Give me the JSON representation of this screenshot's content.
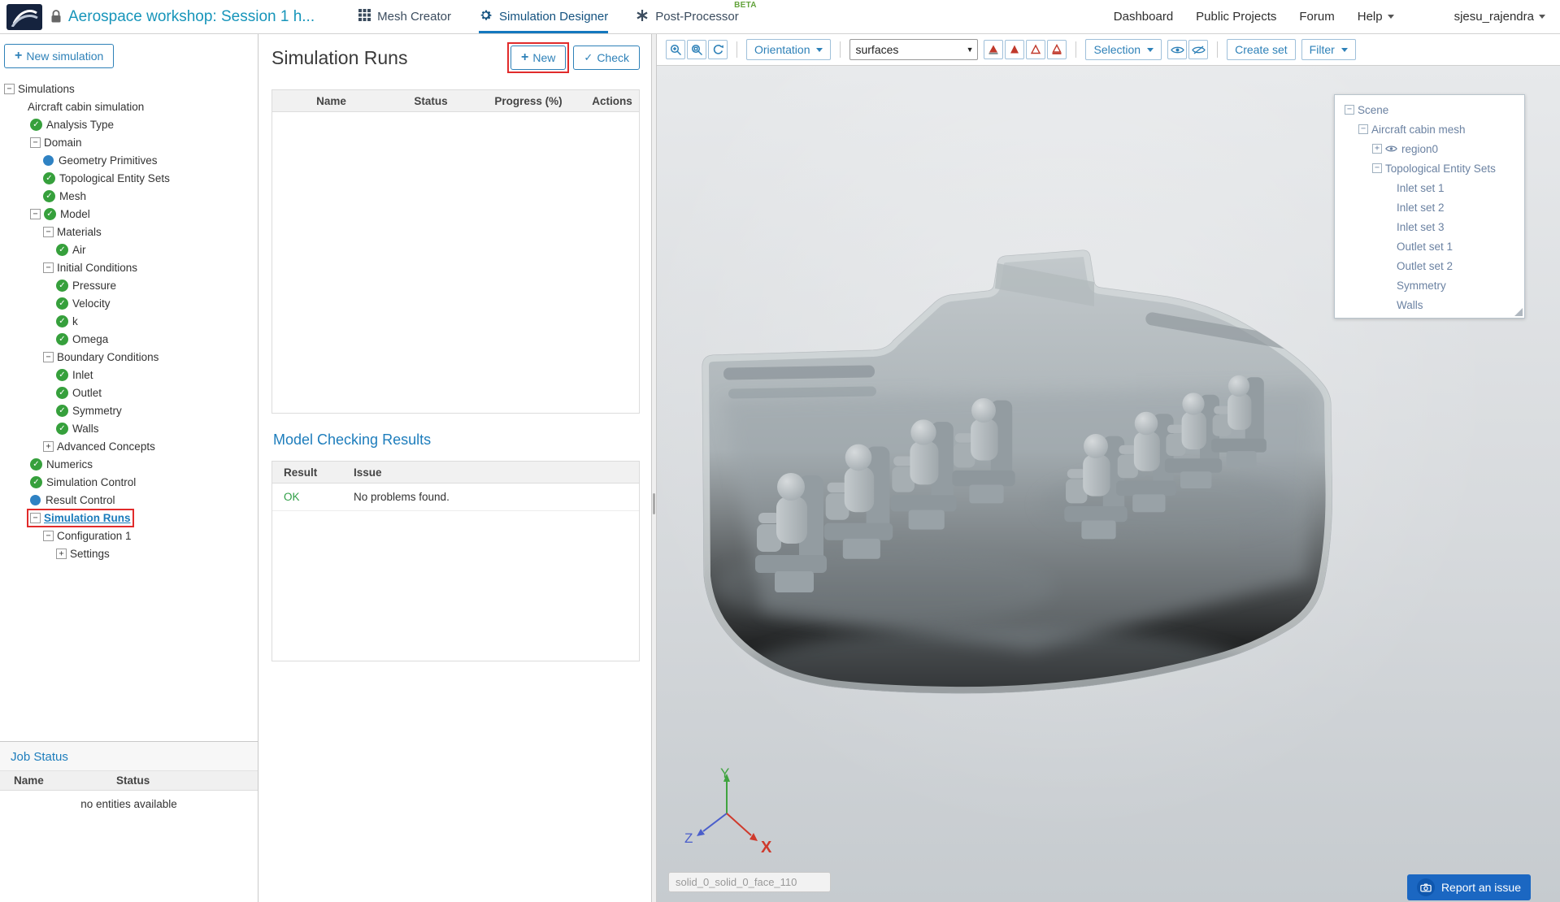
{
  "icons": {
    "plus": "+",
    "check": "✓",
    "collapse": "−",
    "expand": "+",
    "caret_down": "▼"
  },
  "header": {
    "title": "Aerospace workshop: Session 1 h...",
    "tabs": [
      {
        "label": "Mesh Creator"
      },
      {
        "label": "Simulation Designer"
      },
      {
        "label": "Post-Processor",
        "beta": "BETA"
      }
    ],
    "nav": [
      "Dashboard",
      "Public Projects",
      "Forum",
      "Help"
    ],
    "user": "sjesu_rajendra"
  },
  "sidebar": {
    "new_simulation_label": "New simulation",
    "tree": [
      {
        "level": 0,
        "expander": "minus",
        "label": "Simulations"
      },
      {
        "level": 1,
        "label": "Aircraft cabin simulation"
      },
      {
        "level": 2,
        "status": "check",
        "label": "Analysis Type"
      },
      {
        "level": 2,
        "expander": "minus",
        "label": "Domain"
      },
      {
        "level": 3,
        "status": "dot",
        "label": "Geometry Primitives"
      },
      {
        "level": 3,
        "status": "check",
        "label": "Topological Entity Sets"
      },
      {
        "level": 3,
        "status": "check",
        "label": "Mesh"
      },
      {
        "level": 2,
        "expander": "minus",
        "status": "check",
        "label": "Model"
      },
      {
        "level": 3,
        "expander": "minus",
        "label": "Materials"
      },
      {
        "level": 4,
        "status": "check",
        "label": "Air"
      },
      {
        "level": 3,
        "expander": "minus",
        "label": "Initial Conditions"
      },
      {
        "level": 4,
        "status": "check",
        "label": "Pressure"
      },
      {
        "level": 4,
        "status": "check",
        "label": "Velocity"
      },
      {
        "level": 4,
        "status": "check",
        "label": "k"
      },
      {
        "level": 4,
        "status": "check",
        "label": "Omega"
      },
      {
        "level": 3,
        "expander": "minus",
        "label": "Boundary Conditions"
      },
      {
        "level": 4,
        "status": "check",
        "label": "Inlet"
      },
      {
        "level": 4,
        "status": "check",
        "label": "Outlet"
      },
      {
        "level": 4,
        "status": "check",
        "label": "Symmetry"
      },
      {
        "level": 4,
        "status": "check",
        "label": "Walls"
      },
      {
        "level": 3,
        "expander": "plus",
        "label": "Advanced Concepts"
      },
      {
        "level": 2,
        "status": "check",
        "label": "Numerics"
      },
      {
        "level": 2,
        "status": "check",
        "label": "Simulation Control"
      },
      {
        "level": 2,
        "status": "dot",
        "label": "Result Control"
      },
      {
        "level": 2,
        "expander": "minus",
        "label": "Simulation Runs",
        "selected": true
      },
      {
        "level": 3,
        "expander": "minus",
        "label": "Configuration 1"
      },
      {
        "level": 4,
        "expander": "plus",
        "label": "Settings"
      }
    ],
    "job_status": {
      "title": "Job Status",
      "columns": [
        "Name",
        "Status"
      ],
      "empty_text": "no entities available"
    }
  },
  "main": {
    "title": "Simulation Runs",
    "new_label": "New",
    "check_label": "Check",
    "runs_table": {
      "columns": [
        "Name",
        "Status",
        "Progress (%)",
        "Actions"
      ]
    },
    "model_checking": {
      "title": "Model Checking Results",
      "columns": [
        "Result",
        "Issue"
      ],
      "result": "OK",
      "issue": "No problems found."
    }
  },
  "viewport": {
    "toolbar": {
      "orientation": "Orientation",
      "render_mode": "surfaces",
      "selection": "Selection",
      "create_set": "Create set",
      "filter": "Filter"
    },
    "scene_tree": [
      {
        "level": 0,
        "expander": "minus",
        "label": "Scene"
      },
      {
        "level": 1,
        "expander": "minus",
        "label": "Aircraft cabin mesh"
      },
      {
        "level": 2,
        "expander": "plus",
        "eye": true,
        "label": "region0"
      },
      {
        "level": 2,
        "expander": "minus",
        "label": "Topological Entity Sets"
      },
      {
        "level": 3,
        "label": "Inlet set 1"
      },
      {
        "level": 3,
        "label": "Inlet set 2"
      },
      {
        "level": 3,
        "label": "Inlet set 3"
      },
      {
        "level": 3,
        "label": "Outlet set 1"
      },
      {
        "level": 3,
        "label": "Outlet set 2"
      },
      {
        "level": 3,
        "label": "Symmetry"
      },
      {
        "level": 3,
        "label": "Walls"
      }
    ],
    "axis": {
      "x": "X",
      "y": "Y",
      "z": "Z"
    },
    "face_label": "solid_0_solid_0_face_110",
    "report_issue": "Report an issue"
  }
}
